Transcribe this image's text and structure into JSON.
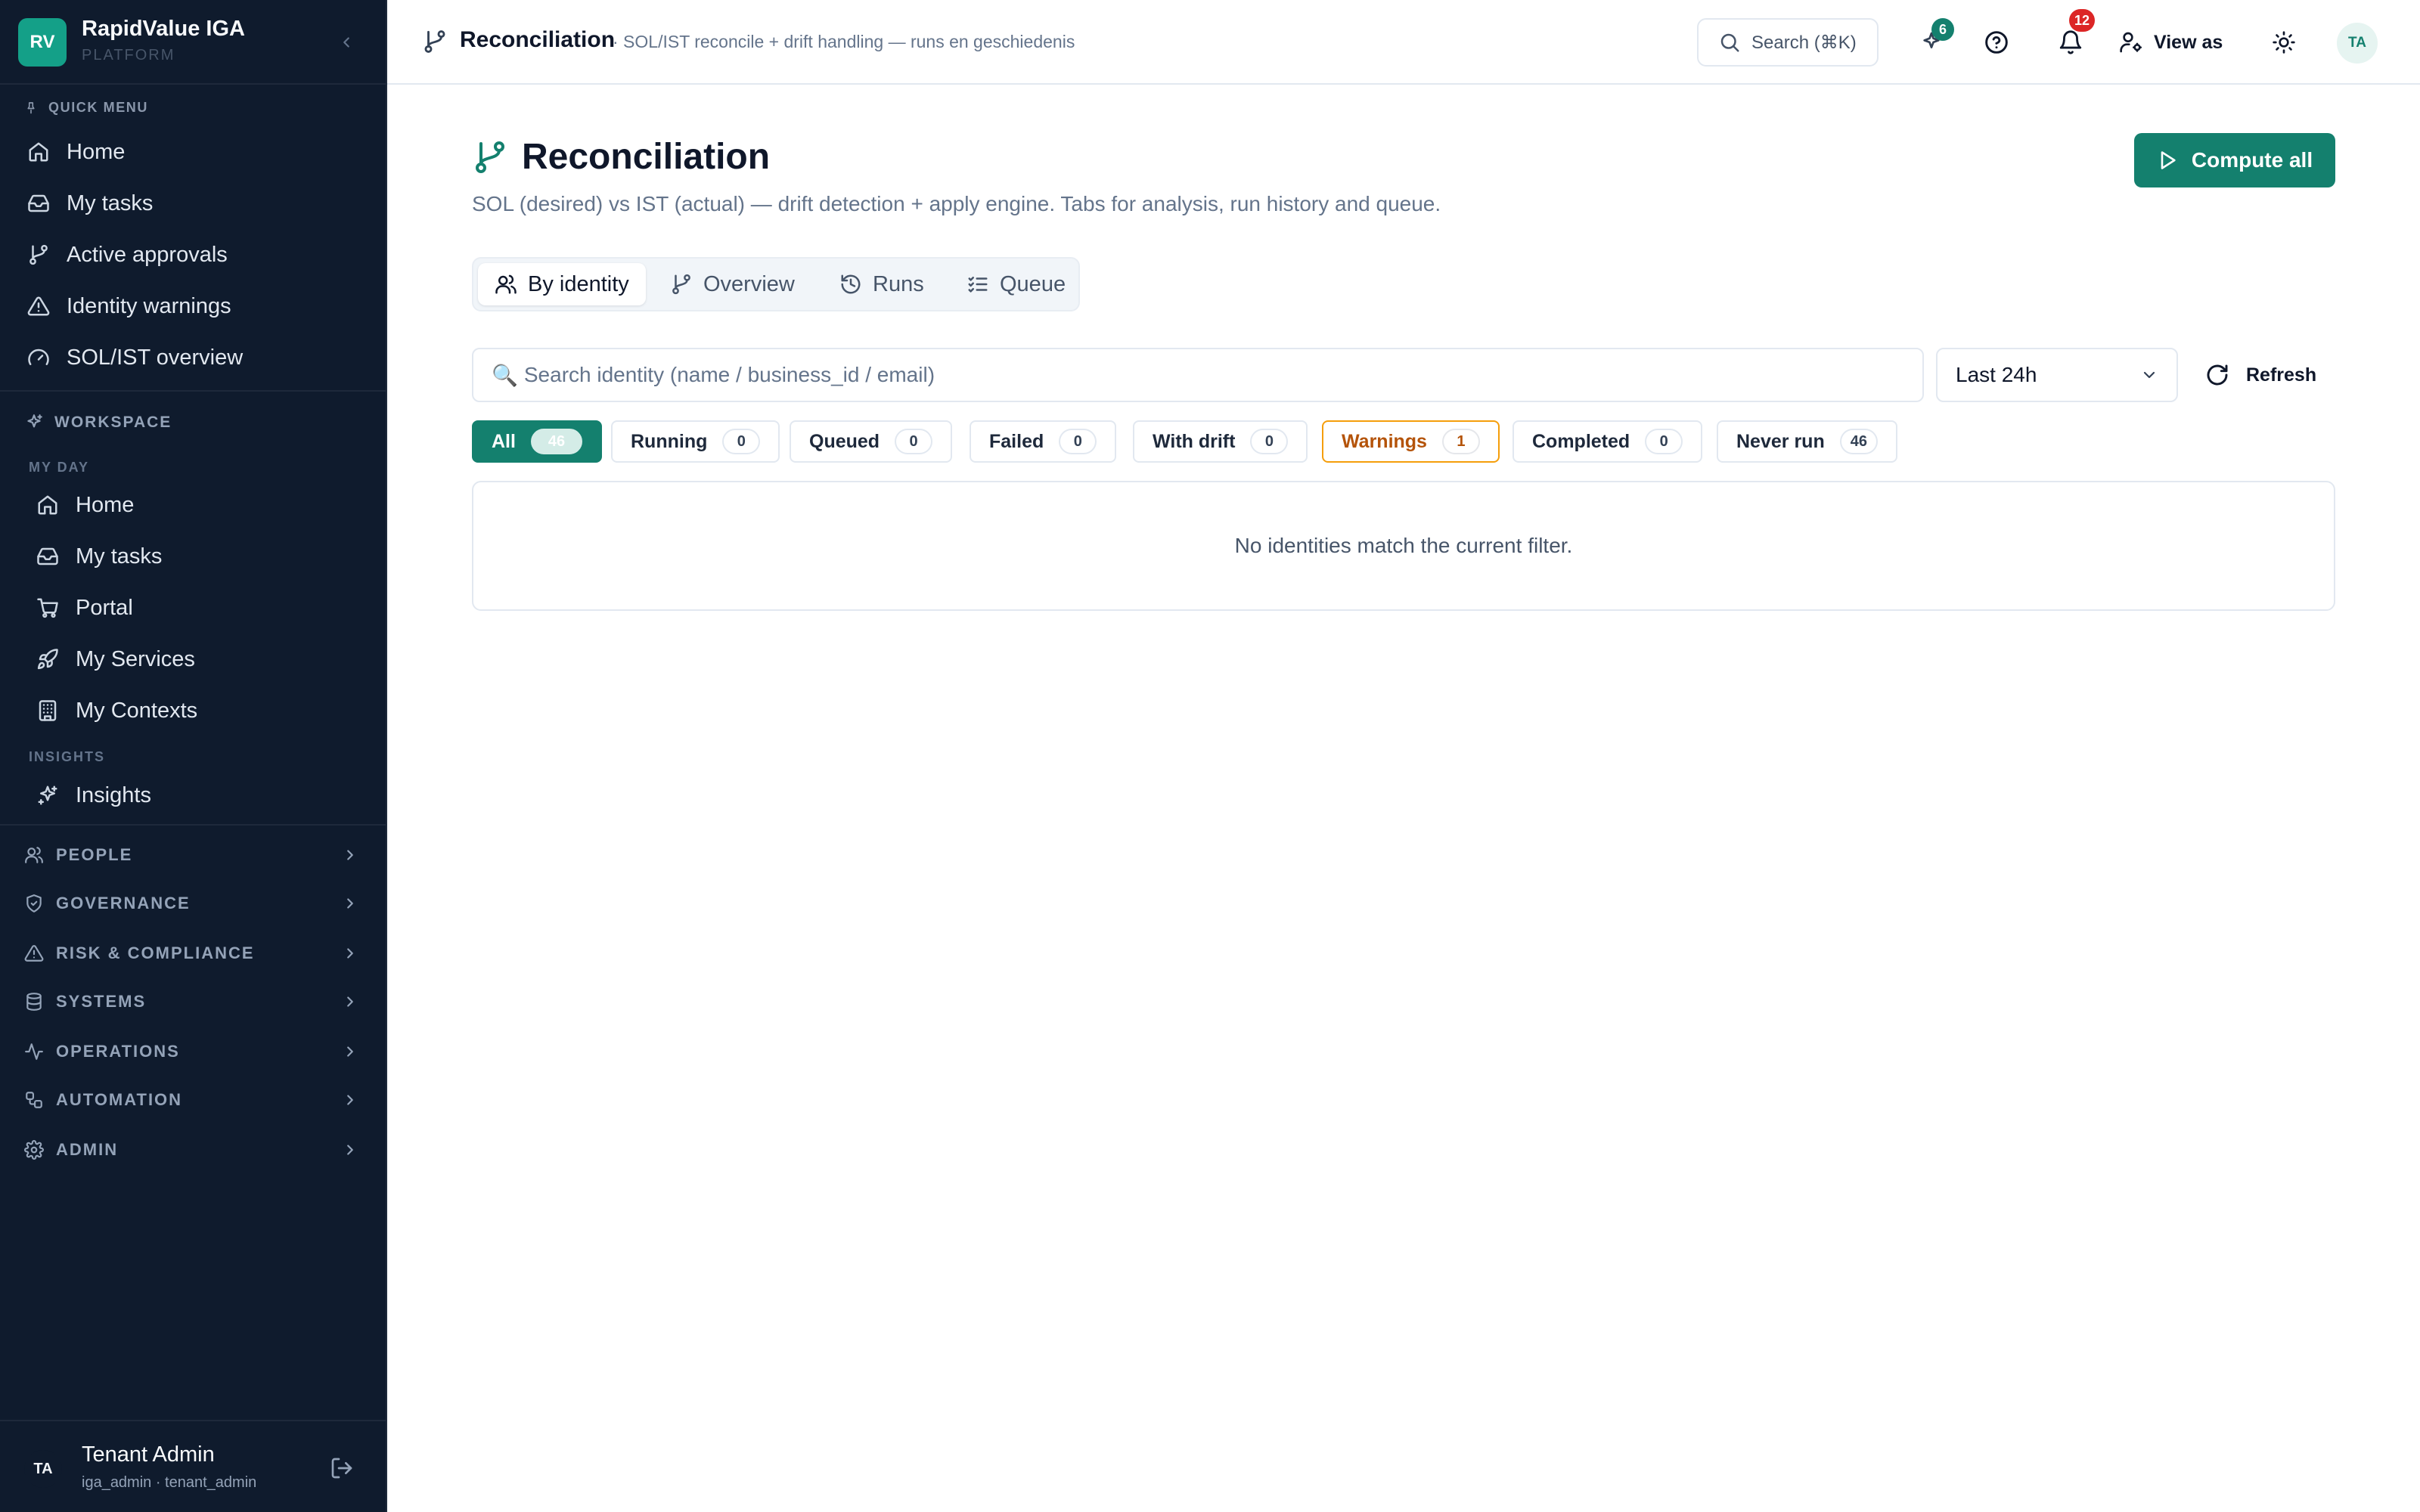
{
  "brand": {
    "logo": "RV",
    "name": "RapidValue IGA",
    "subtitle": "PLATFORM"
  },
  "sidebar": {
    "quick_menu": {
      "heading": "QUICK MENU",
      "items": [
        {
          "label": "Home",
          "icon": "home-icon"
        },
        {
          "label": "My tasks",
          "icon": "inbox-icon"
        },
        {
          "label": "Active approvals",
          "icon": "git-branch-icon"
        },
        {
          "label": "Identity warnings",
          "icon": "warning-icon"
        },
        {
          "label": "SOL/IST overview",
          "icon": "gauge-icon"
        }
      ]
    },
    "workspace": {
      "heading": "WORKSPACE",
      "my_day": {
        "heading": "MY DAY",
        "items": [
          {
            "label": "Home",
            "icon": "home-icon"
          },
          {
            "label": "My tasks",
            "icon": "inbox-icon"
          },
          {
            "label": "Portal",
            "icon": "cart-icon"
          },
          {
            "label": "My Services",
            "icon": "rocket-icon"
          },
          {
            "label": "My Contexts",
            "icon": "building-icon"
          }
        ]
      },
      "insights": {
        "heading": "INSIGHTS",
        "items": [
          {
            "label": "Insights",
            "icon": "sparkles-icon"
          }
        ]
      }
    },
    "groups": [
      {
        "label": "PEOPLE",
        "icon": "users-icon"
      },
      {
        "label": "GOVERNANCE",
        "icon": "shield-icon"
      },
      {
        "label": "RISK & COMPLIANCE",
        "icon": "warning-icon"
      },
      {
        "label": "SYSTEMS",
        "icon": "database-icon"
      },
      {
        "label": "OPERATIONS",
        "icon": "activity-icon"
      },
      {
        "label": "AUTOMATION",
        "icon": "workflow-icon"
      },
      {
        "label": "ADMIN",
        "icon": "gear-icon"
      }
    ],
    "user": {
      "initials": "TA",
      "name": "Tenant Admin",
      "role": "iga_admin · tenant_admin"
    }
  },
  "topbar": {
    "title": "Reconciliation",
    "subtitle": "· SOL/IST reconcile + drift handling — runs en geschiedenis",
    "search_label": "Search (⌘K)",
    "pins_badge": "6",
    "notifications_badge": "12",
    "view_as_label": "View as",
    "avatar_initials": "TA"
  },
  "main": {
    "title": "Reconciliation",
    "subtitle": "SOL (desired) vs IST (actual) — drift detection + apply engine. Tabs for analysis, run history and queue.",
    "compute_label": "Compute all",
    "tabs": [
      {
        "label": "By identity",
        "icon": "users-icon",
        "active": true
      },
      {
        "label": "Overview",
        "icon": "git-branch-icon",
        "active": false
      },
      {
        "label": "Runs",
        "icon": "history-icon",
        "active": false
      },
      {
        "label": "Queue",
        "icon": "list-checks-icon",
        "active": false
      }
    ],
    "search_icon": "🔍",
    "search_placeholder": "Search identity (name / business_id / email)",
    "range_select": "Last 24h",
    "refresh_label": "Refresh",
    "filters": [
      {
        "label": "All",
        "count": "46",
        "state": "active"
      },
      {
        "label": "Running",
        "count": "0",
        "state": ""
      },
      {
        "label": "Queued",
        "count": "0",
        "state": ""
      },
      {
        "label": "Failed",
        "count": "0",
        "state": ""
      },
      {
        "label": "With drift",
        "count": "0",
        "state": ""
      },
      {
        "label": "Warnings",
        "count": "1",
        "state": "warn"
      },
      {
        "label": "Completed",
        "count": "0",
        "state": ""
      },
      {
        "label": "Never run",
        "count": "46",
        "state": ""
      }
    ],
    "empty_message": "No identities match the current filter."
  },
  "colors": {
    "sidebar_bg": "#0f1b2d",
    "accent": "#14806e",
    "warning": "#f59e0b",
    "danger_badge": "#dc2626"
  }
}
